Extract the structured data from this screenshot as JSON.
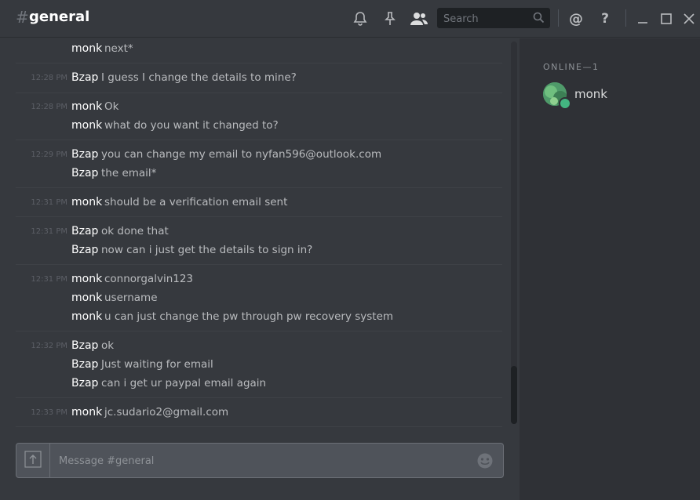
{
  "channel": {
    "hash": "#",
    "name": "general"
  },
  "toolbar": {
    "icons": [
      "bell-icon",
      "pin-icon",
      "members-icon",
      "mention-icon",
      "help-icon",
      "minimize-icon",
      "maximize-icon",
      "close-icon"
    ],
    "search_placeholder": "Search",
    "mention": "@",
    "help": "?"
  },
  "messages": [
    {
      "time": "",
      "lines": [
        {
          "author": "monk",
          "text": "next*"
        }
      ]
    },
    {
      "time": "12:28 PM",
      "lines": [
        {
          "author": "Bzap",
          "text": "I guess I change the details to mine?"
        }
      ]
    },
    {
      "time": "12:28 PM",
      "lines": [
        {
          "author": "monk",
          "text": "Ok"
        },
        {
          "author": "monk",
          "text": "what do you want it changed to?"
        }
      ]
    },
    {
      "time": "12:29 PM",
      "lines": [
        {
          "author": "Bzap",
          "text": "you can change my email to nyfan596@outlook.com"
        },
        {
          "author": "Bzap",
          "text": "the email*"
        }
      ]
    },
    {
      "time": "12:31 PM",
      "lines": [
        {
          "author": "monk",
          "text": "should be a verification email sent"
        }
      ]
    },
    {
      "time": "12:31 PM",
      "lines": [
        {
          "author": "Bzap",
          "text": "ok done that"
        },
        {
          "author": "Bzap",
          "text": "now can i just get the details to sign in?"
        }
      ]
    },
    {
      "time": "12:31 PM",
      "lines": [
        {
          "author": "monk",
          "text": "connorgalvin123"
        },
        {
          "author": "monk",
          "text": "username"
        },
        {
          "author": "monk",
          "text": "u can just change the pw through pw recovery system"
        }
      ]
    },
    {
      "time": "12:32 PM",
      "lines": [
        {
          "author": "Bzap",
          "text": "ok"
        },
        {
          "author": "Bzap",
          "text": "Just waiting for email"
        },
        {
          "author": "Bzap",
          "text": "can i get ur paypal email again"
        }
      ]
    },
    {
      "time": "12:33 PM",
      "lines": [
        {
          "author": "monk",
          "text": "jc.sudario2@gmail.com"
        }
      ]
    }
  ],
  "composer": {
    "placeholder": "Message #general",
    "upload_icon": "upload-icon",
    "emoji_icon": "emoji-icon"
  },
  "members": {
    "header": "ONLINE—1",
    "list": [
      {
        "name": "monk",
        "status": "online",
        "status_color": "#43b581"
      }
    ]
  },
  "colors": {
    "background": "#36393e",
    "sidebar": "#2f3136",
    "online": "#43b581"
  }
}
